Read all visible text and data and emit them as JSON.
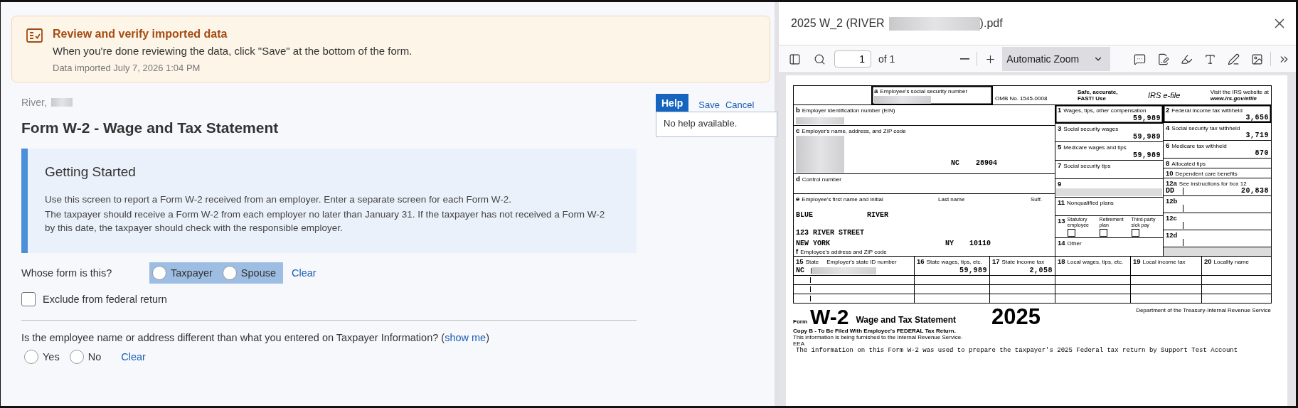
{
  "banner": {
    "title": "Review and verify imported data",
    "message": "When you're done reviewing the data, click \"Save\" at the bottom of the form.",
    "imported": "Data imported July 7, 2026 1:04 PM"
  },
  "person": "River,",
  "form_title": "Form W-2 - Wage and Tax Statement",
  "help": {
    "tab": "Help",
    "save": "Save",
    "cancel": "Cancel",
    "message": "No help available."
  },
  "getting_started": {
    "title": "Getting Started",
    "paragraphs": [
      "Use this screen to report a Form W-2 received from an employer. Enter a separate screen for each Form W-2.",
      "The taxpayer should receive a Form W-2 from each employer no later than January 31. If the taxpayer has not received a Form W-2 by this date, the taxpayer should check with the responsible employer."
    ]
  },
  "whose_form": {
    "label": "Whose form is this?",
    "options": [
      {
        "label": "Taxpayer",
        "selected": false
      },
      {
        "label": "Spouse",
        "selected": false
      }
    ],
    "clear": "Clear"
  },
  "exclude": {
    "label": "Exclude from federal return",
    "checked": false
  },
  "employee_question": {
    "text": "Is the employee name or address different than what you entered on Taxpayer Information? (",
    "link": "show me",
    "text_end": ")",
    "options": [
      {
        "label": "Yes",
        "selected": false
      },
      {
        "label": "No",
        "selected": false
      }
    ],
    "clear": "Clear"
  },
  "viewer": {
    "title_start": "2025 W_2 (RIVER",
    "title_end": ").pdf",
    "page": "1",
    "page_count": "of 1",
    "zoom": "Automatic Zoom"
  },
  "pdf_page": {
    "ssn": {
      "letter": "a",
      "label": "Employee's social security number"
    },
    "omb": "OMB No. 1545-0008",
    "tagline": [
      "Safe, accurate,",
      "FAST! Use"
    ],
    "efile": "IRS e-file",
    "website": [
      "Visit the IRS website at",
      "www.irs.gov/efile"
    ],
    "ein": {
      "letter": "b",
      "label": "Employer identification number (EIN)"
    },
    "employer": {
      "letter": "c",
      "label": "Employer's name, address, and ZIP code",
      "state": "NC",
      "zip": "28904"
    },
    "control": {
      "letter": "d",
      "label": "Control number"
    },
    "employee": {
      "letter": "e",
      "label": "Employee's first name and initial",
      "last_name_label": "Last name",
      "suffix_label": "Suff.",
      "first_name": "BLUE",
      "last_name": "RIVER",
      "street": "123 RIVER STREET",
      "city": "NEW YORK",
      "state": "NY",
      "zip": "10110",
      "address_letter": "f",
      "address_label": "Employee's address and ZIP code"
    },
    "middle_boxes": [
      {
        "kind": "amount",
        "num": "1",
        "label": "Wages, tips, other compensation",
        "value": "59,989"
      },
      {
        "kind": "amount",
        "num": "3",
        "label": "Social security wages",
        "value": "59,989"
      },
      {
        "kind": "amount",
        "num": "5",
        "label": "Medicare wages and tips",
        "value": "59,989"
      },
      {
        "kind": "amount",
        "num": "7",
        "label": "Social security tips"
      },
      {
        "kind": "shaded",
        "num": "9"
      },
      {
        "kind": "amount",
        "num": "11",
        "label": "Nonqualified plans"
      },
      {
        "kind": "checkboxes",
        "num": "13",
        "options": [
          {
            "label": "Statutory employee",
            "checked": false
          },
          {
            "label": "Retirement plan",
            "checked": false
          },
          {
            "label": "Third-party sick pay",
            "checked": false
          }
        ]
      },
      {
        "kind": "amount",
        "num": "14",
        "label": "Other"
      }
    ],
    "right_boxes": [
      {
        "kind": "amount",
        "num": "2",
        "label": "Federal income tax withheld",
        "value": "3,656"
      },
      {
        "kind": "amount",
        "num": "4",
        "label": "Social security tax withheld",
        "value": "3,719"
      },
      {
        "kind": "amount",
        "num": "6",
        "label": "Medicare tax withheld",
        "value": "870"
      },
      {
        "kind": "amount",
        "num": "8",
        "label": "Allocated tips"
      },
      {
        "kind": "amount",
        "num": "10",
        "label": "Dependent care benefits"
      },
      {
        "kind": "code",
        "num": "12a",
        "label": "See instructions for box 12",
        "code": "DD",
        "value": "20,838"
      },
      {
        "kind": "code",
        "num": "12b"
      },
      {
        "kind": "code",
        "num": "12c"
      },
      {
        "kind": "code",
        "num": "12d"
      }
    ],
    "state_columns": [
      {
        "kind": "state",
        "num": "15",
        "label": "State",
        "sublabel": "Employer's state ID number",
        "value": "NC"
      },
      {
        "kind": "amount",
        "num": "16",
        "label": "State wages, tips, etc.",
        "value": "59,989"
      },
      {
        "kind": "amount",
        "num": "17",
        "label": "State income tax",
        "value": "2,058"
      },
      {
        "kind": "amount",
        "num": "18",
        "label": "Local wages, tips, etc."
      },
      {
        "kind": "amount",
        "num": "19",
        "label": "Local income tax"
      },
      {
        "kind": "amount",
        "num": "20",
        "label": "Locality name"
      }
    ],
    "footer": {
      "form_word": "Form",
      "form_name": "W-2",
      "title": "Wage and Tax Statement",
      "year": "2025",
      "department": "Department of the Treasury-Internal Revenue Service",
      "copy": "Copy B - To Be Filed With Employee's FEDERAL Tax Return.",
      "furnished": "This information is being furnished to the Internal Revenue Service.",
      "eea": "EEA",
      "note": "The information on this Form W-2 was used to prepare the taxpayer's 2025 Federal tax return by Support Test Account"
    }
  }
}
